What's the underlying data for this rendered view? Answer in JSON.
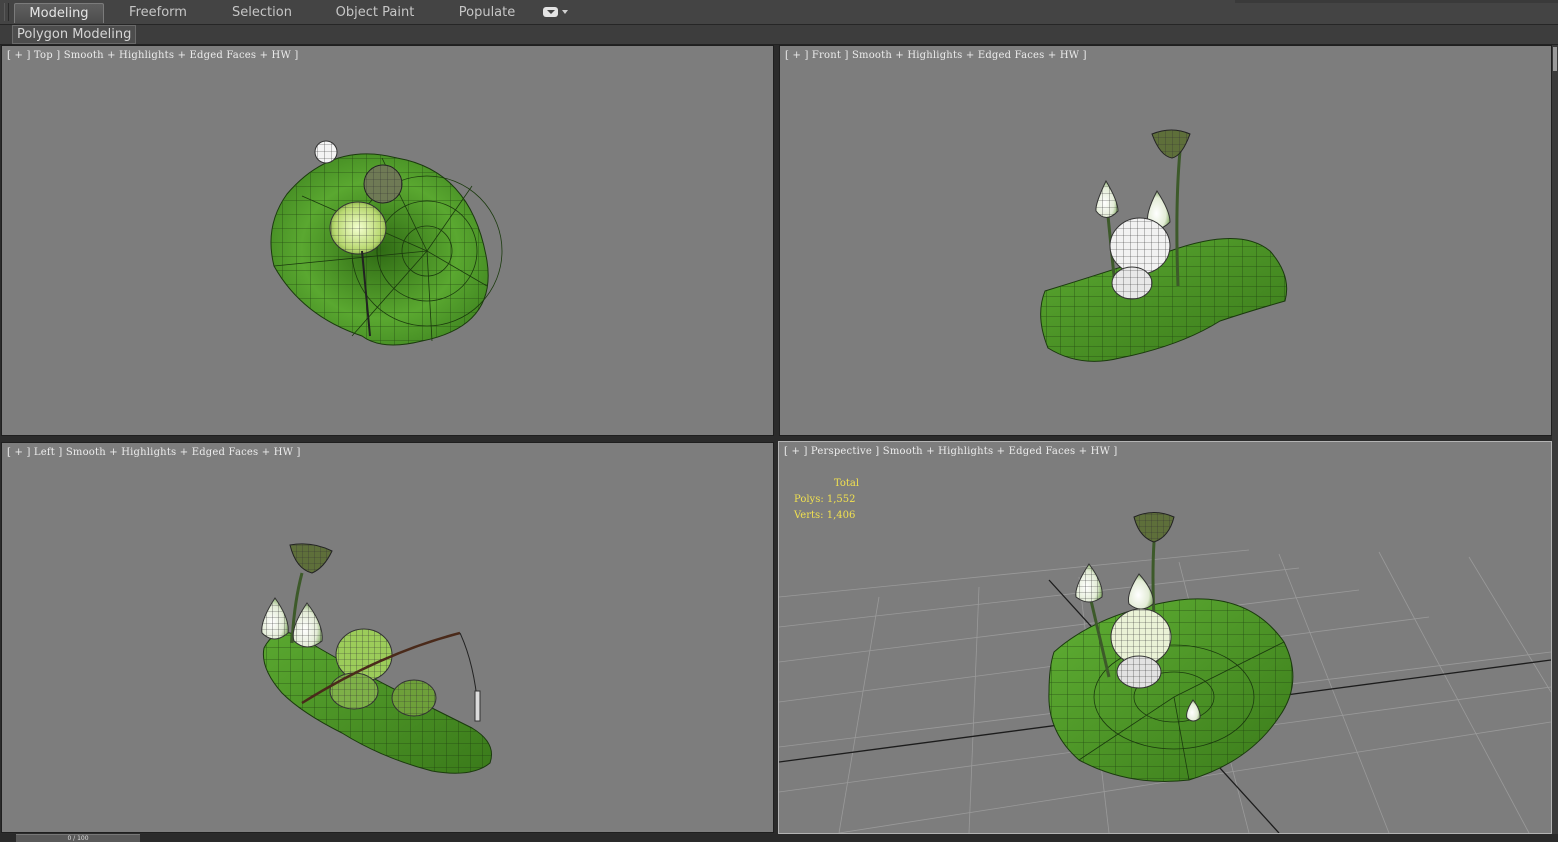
{
  "ribbon": {
    "tabs": [
      {
        "label": "Modeling",
        "active": true
      },
      {
        "label": "Freeform",
        "active": false
      },
      {
        "label": "Selection",
        "active": false
      },
      {
        "label": "Object Paint",
        "active": false
      },
      {
        "label": "Populate",
        "active": false
      }
    ],
    "options_icon": "toggle-ribbon-icon",
    "panel_label": "Polygon Modeling"
  },
  "viewports": {
    "top": {
      "label": "[ + ] Top ] Smooth + Highlights + Edged Faces + HW ]"
    },
    "front": {
      "label": "[ + ] Front ] Smooth + Highlights + Edged Faces + HW ]"
    },
    "left": {
      "label": "[ + ] Left ] Smooth + Highlights + Edged Faces + HW ]"
    },
    "perspective": {
      "label": "[ + ] Perspective ] Smooth + Highlights + Edged Faces + HW ]",
      "stats": {
        "title": "Total",
        "polys": "Polys: 1,552",
        "verts": "Verts: 1,406"
      }
    }
  },
  "colors": {
    "viewport_bg": "#7d7d7d",
    "leaf_green": "#4f9a2a",
    "stats_yellow": "#f0e050",
    "active_border": "#b4b4b4"
  },
  "timeline": {
    "frame": "0 / 100"
  }
}
